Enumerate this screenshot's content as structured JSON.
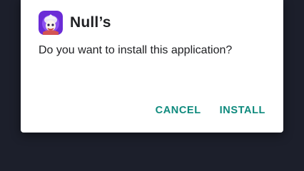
{
  "dialog": {
    "app_name": "Null’s",
    "app_icon": "brawl-stars-character-icon",
    "message": "Do you want to install this application?",
    "cancel_label": "CANCEL",
    "install_label": "INSTALL"
  },
  "colors": {
    "background": "#1c1f2b",
    "dialog": "#ffffff",
    "accent": "#0e8a7d",
    "text": "#202124",
    "icon_bg": "#6a2bd6"
  }
}
